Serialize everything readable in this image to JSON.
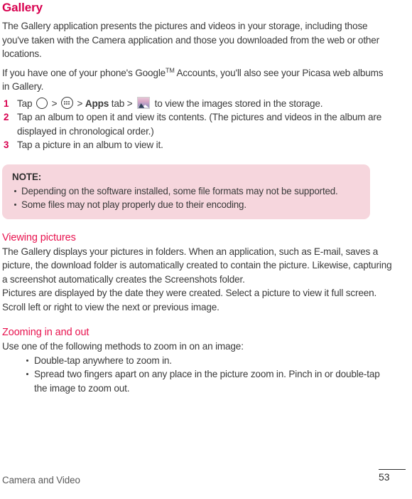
{
  "page": {
    "title": "Gallery",
    "footer_label": "Camera and Video",
    "page_number": "53",
    "accent_color": "#d8004f",
    "subheading_color": "#e8134f",
    "note_background": "#f6d6dd"
  },
  "intro": {
    "paragraph_1": "The Gallery application presents the pictures and videos in your storage, including those you've taken with the Camera application and those you downloaded from the web or other locations.",
    "paragraph_2_pre": "If you have one of your phone's Google",
    "paragraph_2_tm": "TM",
    "paragraph_2_post": " Accounts, you'll also see your Picasa web albums in Gallery."
  },
  "steps": [
    {
      "number": "1",
      "prefix": "Tap ",
      "icon_home": "home-circle-icon",
      "sep_1": " > ",
      "icon_apps": "apps-grid-icon",
      "sep_2": " > ",
      "bold_label": "Apps",
      "mid": " tab > ",
      "icon_gallery": "gallery-thumbnail-icon",
      "suffix": " to view the images stored in the storage."
    },
    {
      "number": "2",
      "text": "Tap an album to open it and view its contents. (The pictures and videos in the album are displayed in chronological order.)"
    },
    {
      "number": "3",
      "text": "Tap a picture in an album to view it."
    }
  ],
  "note": {
    "title": "NOTE:",
    "items": [
      "Depending on the software installed, some file formats may not be supported.",
      "Some files may not play properly due to their encoding."
    ]
  },
  "viewing_pictures": {
    "heading": "Viewing pictures",
    "paragraph_1": "The Gallery displays your pictures in folders. When an application, such as E-mail, saves a picture, the download folder is automatically created to contain the picture. Likewise, capturing a screenshot automatically creates the Screenshots folder.",
    "paragraph_2": "Pictures are displayed by the date they were created. Select a picture to view it full screen. Scroll left or right to view the next or previous image."
  },
  "zooming": {
    "heading": "Zooming in and out",
    "intro": "Use one of the following methods to zoom in on an image:",
    "items": [
      "Double-tap anywhere to zoom in.",
      "Spread two fingers apart on any place in the picture zoom in. Pinch in or double-tap the image to zoom out."
    ]
  }
}
